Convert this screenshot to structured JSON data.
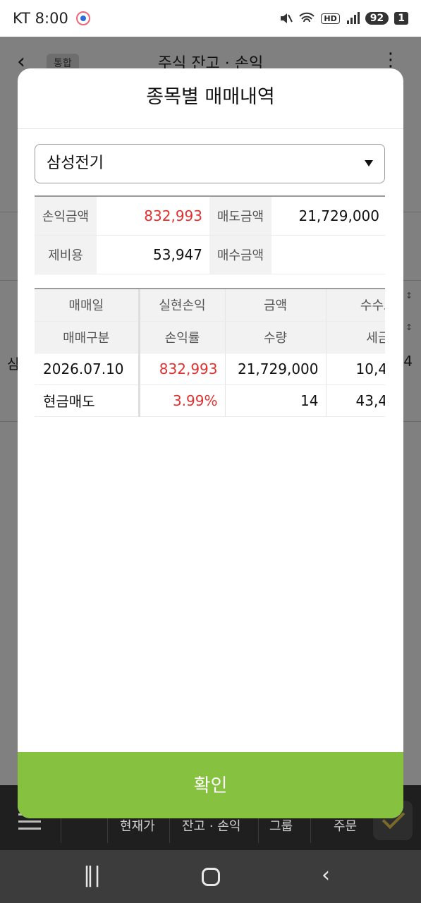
{
  "status_bar": {
    "carrier_time": "KT 8:00",
    "hd": "HD",
    "battery": "92",
    "sim": "1"
  },
  "background": {
    "title": "주식 잔고 · 손익",
    "tag": "통합",
    "peek_left": "삼",
    "peek_right": "4",
    "bottom_nav": [
      "현재가",
      "잔고 · 손익",
      "그룹",
      "주문"
    ]
  },
  "modal": {
    "title": "종목별 매매내역",
    "stock_select": "삼성전기",
    "summary": {
      "profit_label": "손익금액",
      "profit_value": "832,993",
      "sell_label": "매도금액",
      "sell_value": "21,729,000",
      "fee_label": "제비용",
      "fee_value": "53,947",
      "buy_label": "매수금액",
      "buy_value": ""
    },
    "trade_table": {
      "headers_row1": [
        "매매일",
        "실현손익",
        "금액",
        "수수료"
      ],
      "headers_row2": [
        "매매구분",
        "손익률",
        "수량",
        "세금"
      ],
      "rows": [
        [
          "2026.07.10",
          "832,993",
          "21,729,000",
          "10,4"
        ],
        [
          "현금매도",
          "3.99%",
          "14",
          "43,4"
        ]
      ]
    },
    "confirm_label": "확인"
  },
  "colors": {
    "accent_green": "#86c240",
    "profit_red": "#e03030"
  }
}
